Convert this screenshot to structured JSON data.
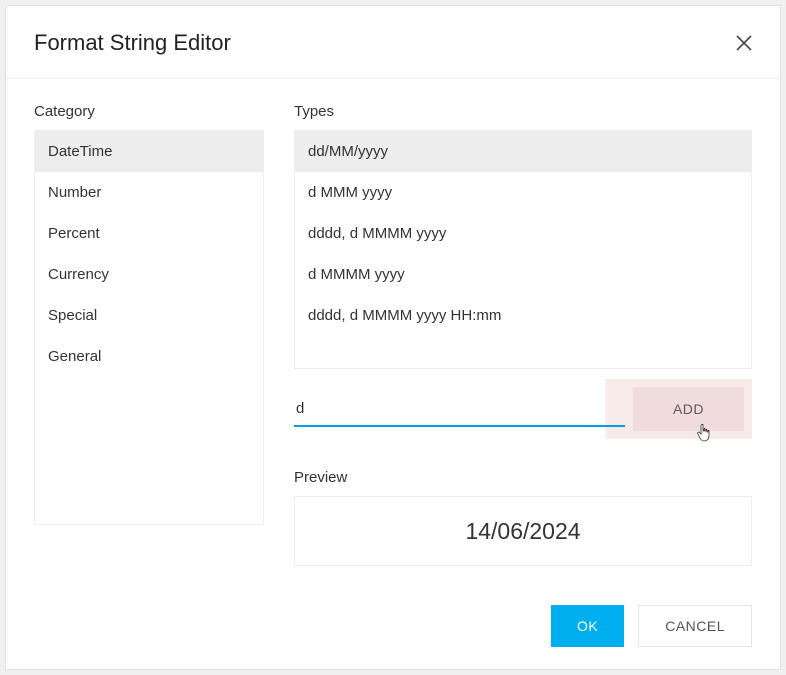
{
  "dialog": {
    "title": "Format String Editor"
  },
  "category": {
    "label": "Category",
    "items": [
      {
        "label": "DateTime",
        "selected": true
      },
      {
        "label": "Number",
        "selected": false
      },
      {
        "label": "Percent",
        "selected": false
      },
      {
        "label": "Currency",
        "selected": false
      },
      {
        "label": "Special",
        "selected": false
      },
      {
        "label": "General",
        "selected": false
      }
    ]
  },
  "types": {
    "label": "Types",
    "items": [
      {
        "label": "dd/MM/yyyy",
        "selected": true
      },
      {
        "label": "d MMM yyyy",
        "selected": false
      },
      {
        "label": "dddd, d MMMM yyyy",
        "selected": false
      },
      {
        "label": "d MMMM yyyy",
        "selected": false
      },
      {
        "label": "dddd, d MMMM yyyy HH:mm",
        "selected": false
      }
    ]
  },
  "input": {
    "value": "d"
  },
  "add_button": {
    "label": "ADD"
  },
  "preview": {
    "label": "Preview",
    "value": "14/06/2024"
  },
  "footer": {
    "ok": "OK",
    "cancel": "CANCEL"
  }
}
